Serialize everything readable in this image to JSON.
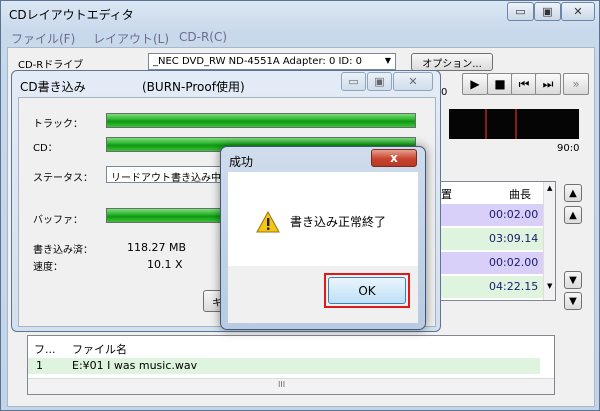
{
  "app": {
    "title": "CDレイアウトエディタ",
    "caption_buttons": {
      "minimize": "▭",
      "maximize": "▣",
      "close": "✕"
    },
    "menu": [
      "ファイル(F)",
      "レイアウト(L)",
      "CD-R(C)"
    ]
  },
  "toolbar": {
    "drive_label": "CD-Rドライブ",
    "drive_value": "_NEC  DVD_RW ND-4551A  Adapter: 0  ID: 0",
    "options_label": "オプション...",
    "time_readout": "0",
    "meter_end": "90:0",
    "transport": {
      "play": "▶",
      "stop": "■",
      "prev": "⏮",
      "next": "⏭",
      "forward": "»"
    }
  },
  "track_table": {
    "columns": [
      "置",
      "曲長"
    ],
    "lengths": [
      "00:02.00",
      "03:09.14",
      "00:02.00",
      "04:22.15"
    ],
    "row_colors": [
      "#d8d0f8",
      "#dff4df",
      "#d8d0f8",
      "#dff4df"
    ]
  },
  "file_list": {
    "columns": [
      "フ...",
      "ファイル名"
    ],
    "rows": [
      {
        "index": "1",
        "name": "E:¥01 I was music.wav"
      }
    ],
    "scroll_thumb": "III"
  },
  "burn_dialog": {
    "title": "CD書き込み",
    "subtitle": "(BURN-Proof使用)",
    "track_label": "トラック：",
    "cd_label": "CD：",
    "status_label": "ステータス：",
    "status_value": "リードアウト書き込み中",
    "buffer_label": "バッファ：",
    "written_label": "書き込み済：",
    "written_value": "118.27 MB",
    "speed_label": "速度：",
    "speed_value": "10.1 X",
    "cancel_label": "キ",
    "progress": {
      "track": 1.0,
      "cd": 1.0,
      "buffer": 1.0
    }
  },
  "success_dialog": {
    "title": "成功",
    "message": "書き込み正常終了",
    "ok_label": "OK",
    "icon": "warning-icon",
    "close_glyph": "x"
  },
  "colors": {
    "progress_green": "#1faa1f",
    "highlight_red": "#e01a1a"
  }
}
